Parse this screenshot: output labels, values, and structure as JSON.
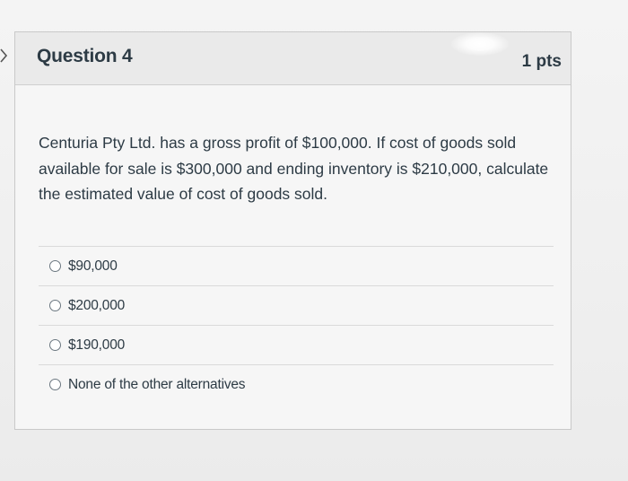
{
  "question": {
    "title": "Question 4",
    "points": "1 pts",
    "text": "Centuria Pty Ltd. has a gross profit of $100,000. If cost of goods sold available for sale is $300,000 and ending inventory is $210,000, calculate the estimated value of cost of goods sold."
  },
  "answers": [
    {
      "label": "$90,000"
    },
    {
      "label": "$200,000"
    },
    {
      "label": "$190,000"
    },
    {
      "label": "None of the other alternatives"
    }
  ],
  "icons": {
    "left_nav": "chevron-right-icon",
    "answer_marker": "radio-unselected-icon"
  },
  "colors": {
    "text": "#2d3b45",
    "header_bg": "#eaeaea",
    "card_bg": "#f6f6f6",
    "border": "#c9c9c9"
  }
}
